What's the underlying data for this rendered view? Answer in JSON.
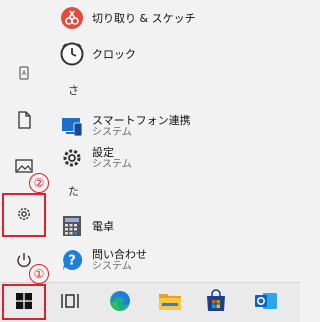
{
  "start_menu": {
    "app_list": [
      {
        "name": "切り取り & スケッチ",
        "sub": "",
        "icon": "snip-sketch-icon"
      },
      {
        "name": "クロック",
        "sub": "",
        "icon": "clock-icon"
      },
      {
        "name": "スマートフォン連携",
        "sub": "システム",
        "icon": "phone-link-icon"
      },
      {
        "name": "設定",
        "sub": "システム",
        "icon": "settings-gear-icon"
      },
      {
        "name": "電卓",
        "sub": "",
        "icon": "calculator-icon"
      },
      {
        "name": "問い合わせ",
        "sub": "システム",
        "icon": "get-help-icon"
      }
    ],
    "section_letters": [
      "さ",
      "た"
    ]
  },
  "left_rail": {
    "items": [
      "user-icon",
      "document-icon",
      "pictures-icon",
      "settings-gear-icon",
      "power-icon"
    ]
  },
  "taskbar": {
    "items": [
      "windows-start-icon",
      "task-view-icon",
      "edge-icon",
      "file-explorer-icon",
      "microsoft-store-icon",
      "outlook-icon"
    ]
  },
  "annotations": {
    "callout_1": "①",
    "callout_2": "②",
    "accent_color": "#e0202a"
  }
}
